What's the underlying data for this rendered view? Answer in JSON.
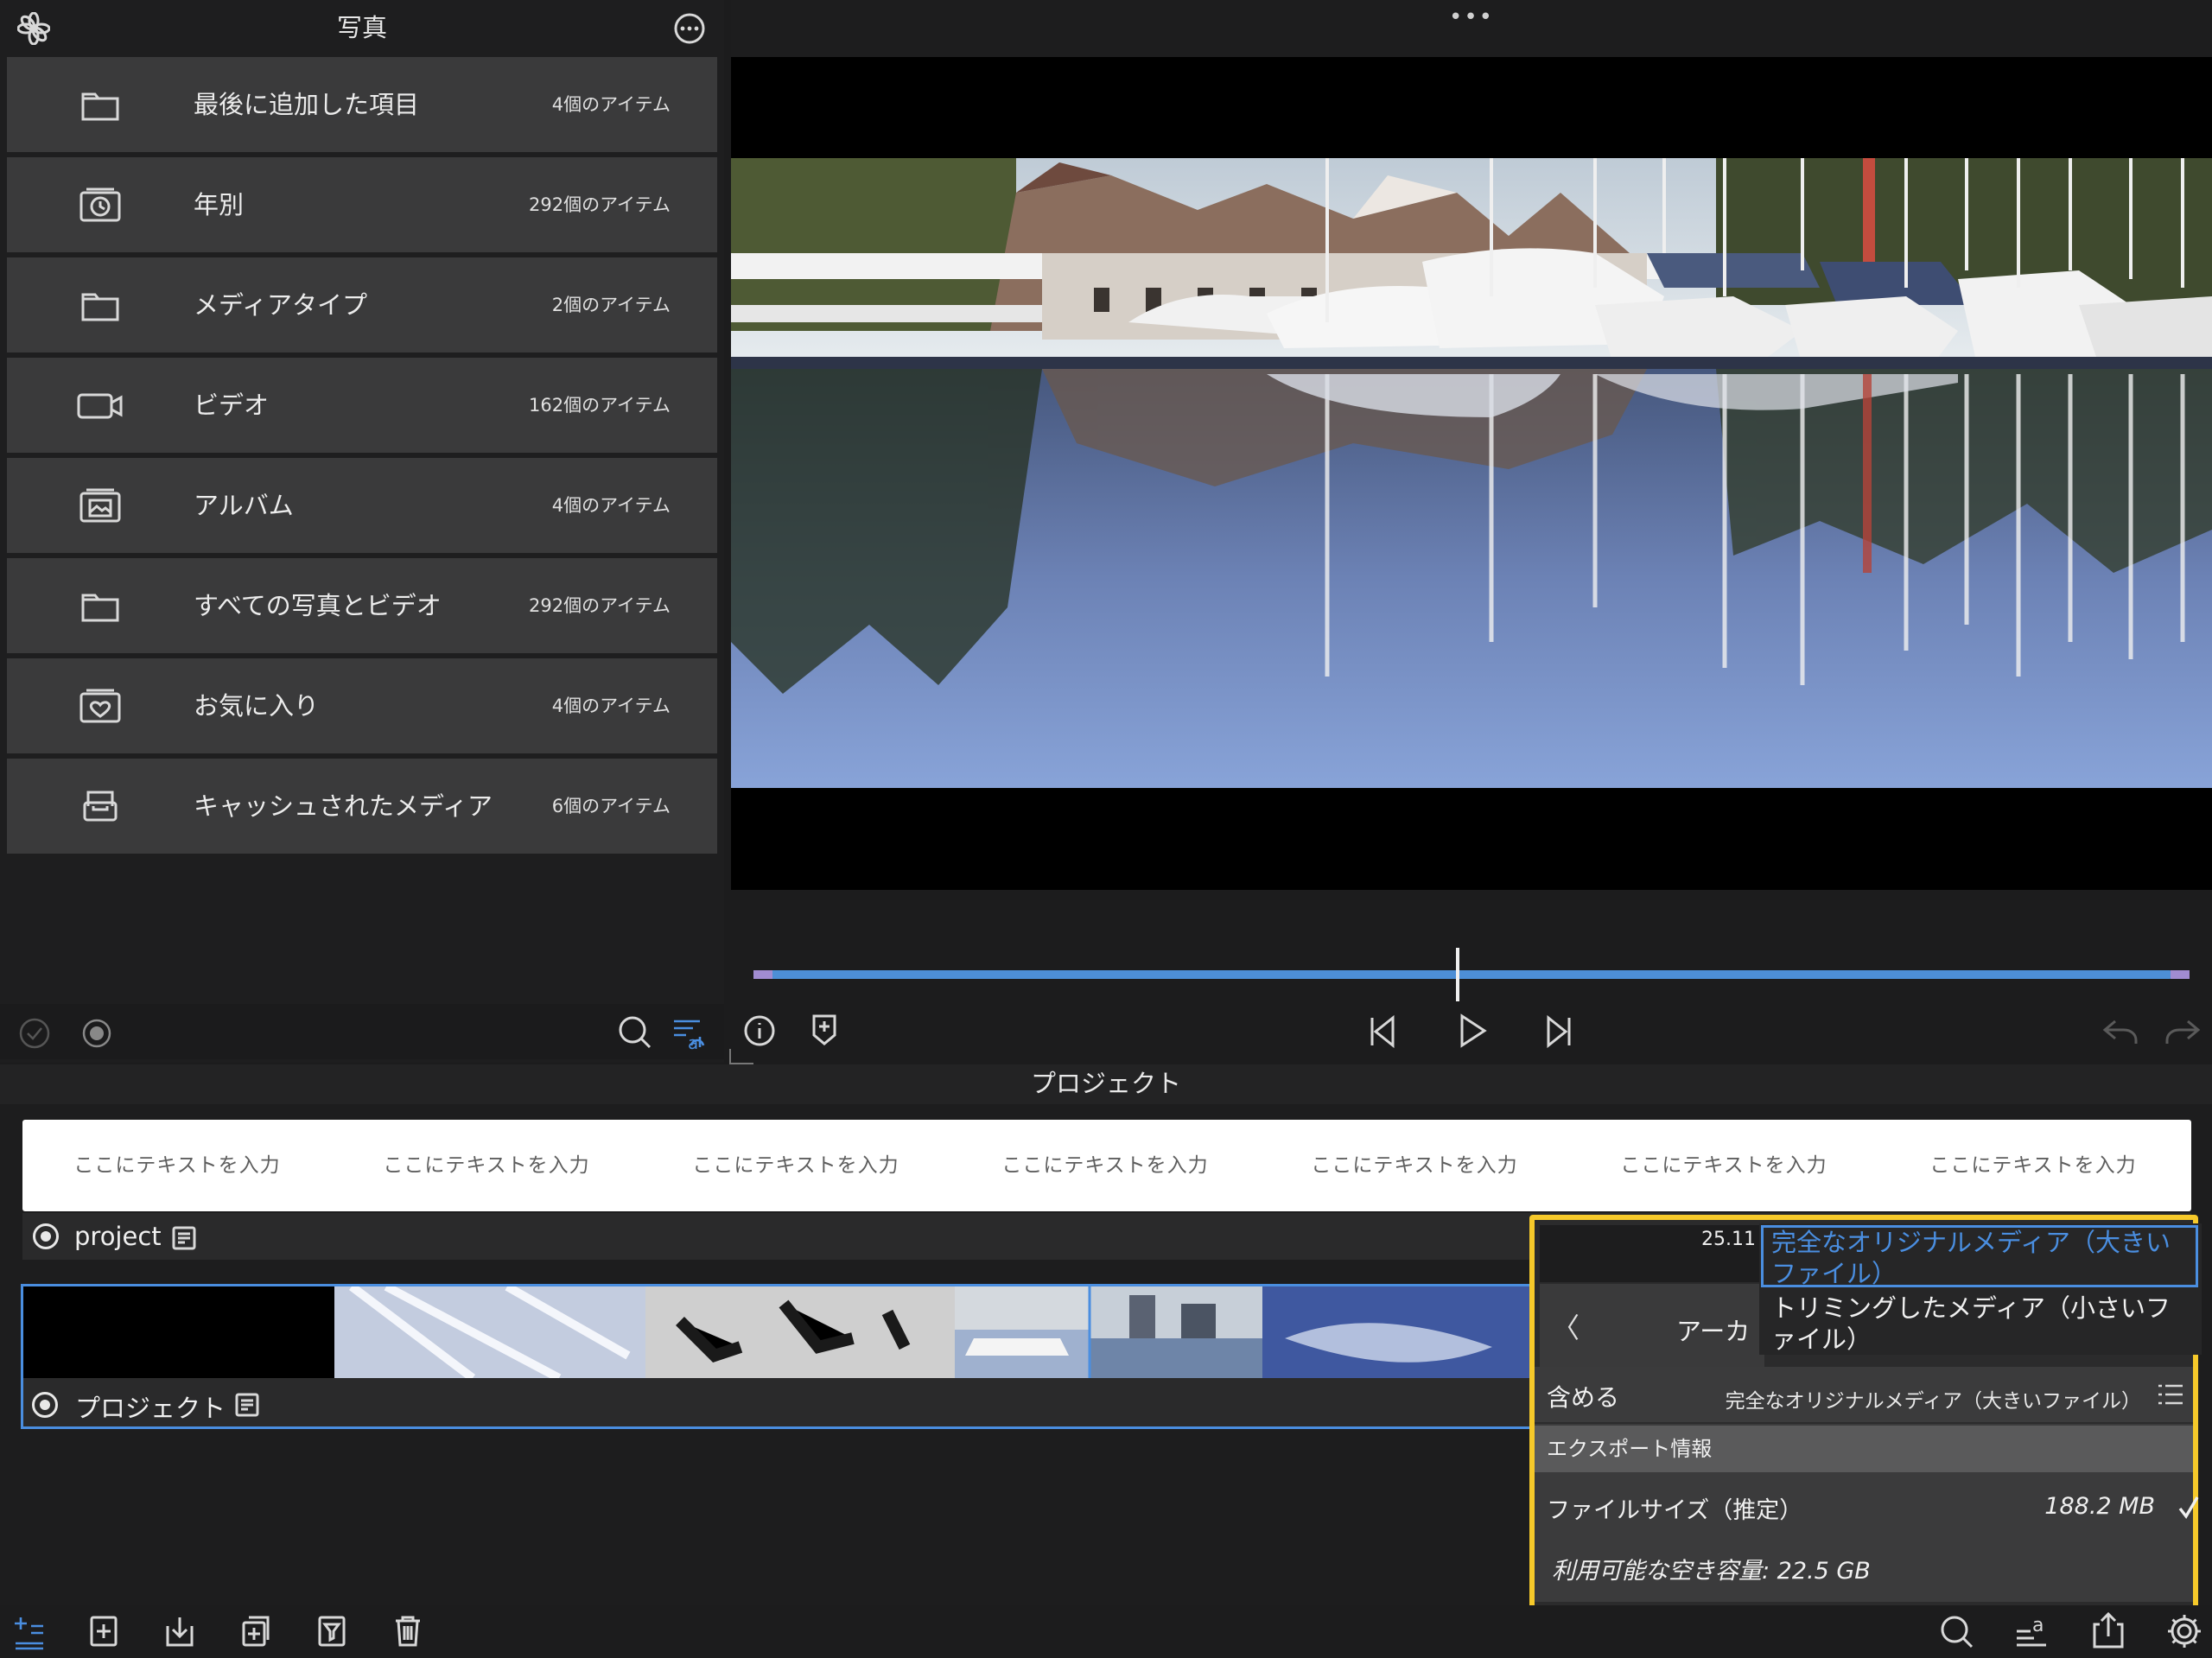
{
  "library": {
    "title": "写真",
    "items": [
      {
        "label": "最後に追加した項目",
        "count": "4個のアイテム",
        "icon": "folder-icon"
      },
      {
        "label": "年別",
        "count": "292個のアイテム",
        "icon": "clock-stack-icon"
      },
      {
        "label": "メディアタイプ",
        "count": "2個のアイテム",
        "icon": "folder-icon"
      },
      {
        "label": "ビデオ",
        "count": "162個のアイテム",
        "icon": "video-camera-icon"
      },
      {
        "label": "アルバム",
        "count": "4個のアイテム",
        "icon": "photo-stack-icon"
      },
      {
        "label": "すべての写真とビデオ",
        "count": "292個のアイテム",
        "icon": "folder-icon"
      },
      {
        "label": "お気に入り",
        "count": "4個のアイテム",
        "icon": "heart-stack-icon"
      },
      {
        "label": "キャッシュされたメディア",
        "count": "6個のアイテム",
        "icon": "tray-icon"
      }
    ]
  },
  "viewer": {
    "more_label": "•••"
  },
  "project": {
    "header_title": "プロジェクト",
    "titles_placeholder": [
      "ここにテキストを入力",
      "ここにテキストを入力",
      "ここにテキストを入力",
      "ここにテキストを入力",
      "ここにテキストを入力",
      "ここにテキストを入力",
      "ここにテキストを入力"
    ],
    "track1_name": "project",
    "track2_name": "プロジェクト",
    "timecode": "25.11"
  },
  "export_popover": {
    "back_label": "〈",
    "title_partial": "アーカ",
    "options": [
      "完全なオリジナルメディア（大きいファイル）",
      "トリミングしたメディア（小さいファイル）"
    ],
    "include_label": "含める",
    "include_value": "完全なオリジナルメディア（大きいファイル）",
    "info_header": "エクスポート情報",
    "filesize_label": "ファイルサイズ（推定）",
    "filesize_value": "188.2 MB",
    "free_space": "利用可能な空き容量: 22.5 GB"
  },
  "colors": {
    "accent": "#4a8ee0",
    "highlight": "#f6c92a",
    "scrub": "#4d8fd6",
    "trim_handle": "#a18cd1"
  }
}
